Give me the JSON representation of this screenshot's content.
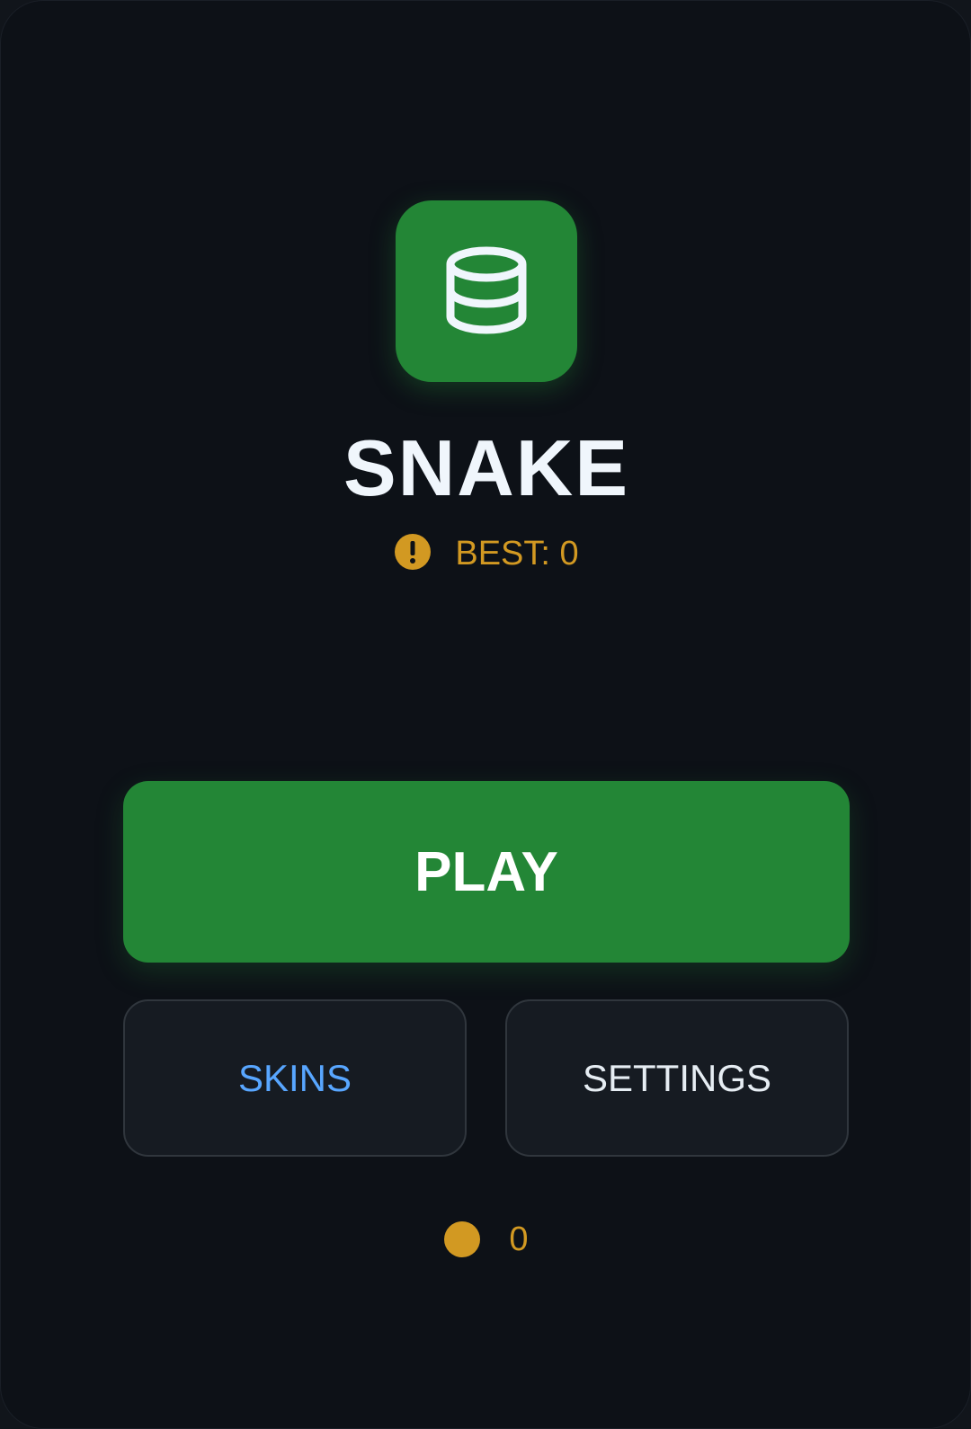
{
  "app": {
    "title": "SNAKE",
    "logo_icon": "database-icon",
    "accent_color": "#238636"
  },
  "best": {
    "label": "BEST: 0",
    "icon": "alert-circle-icon",
    "color": "#d29922"
  },
  "buttons": {
    "play": "PLAY",
    "skins": "SKINS",
    "settings": "SETTINGS"
  },
  "coins": {
    "icon": "coin-icon",
    "count": "0"
  }
}
